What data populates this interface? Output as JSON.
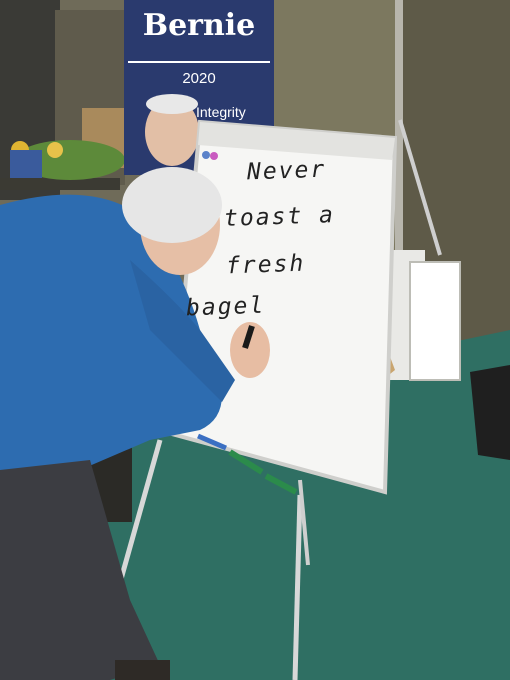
{
  "banner": {
    "title": "Bernie",
    "year": "2020",
    "tagline": "Integrity"
  },
  "whiteboard": {
    "lines": [
      "Never",
      "toast a",
      "fresh",
      "bagel"
    ]
  }
}
